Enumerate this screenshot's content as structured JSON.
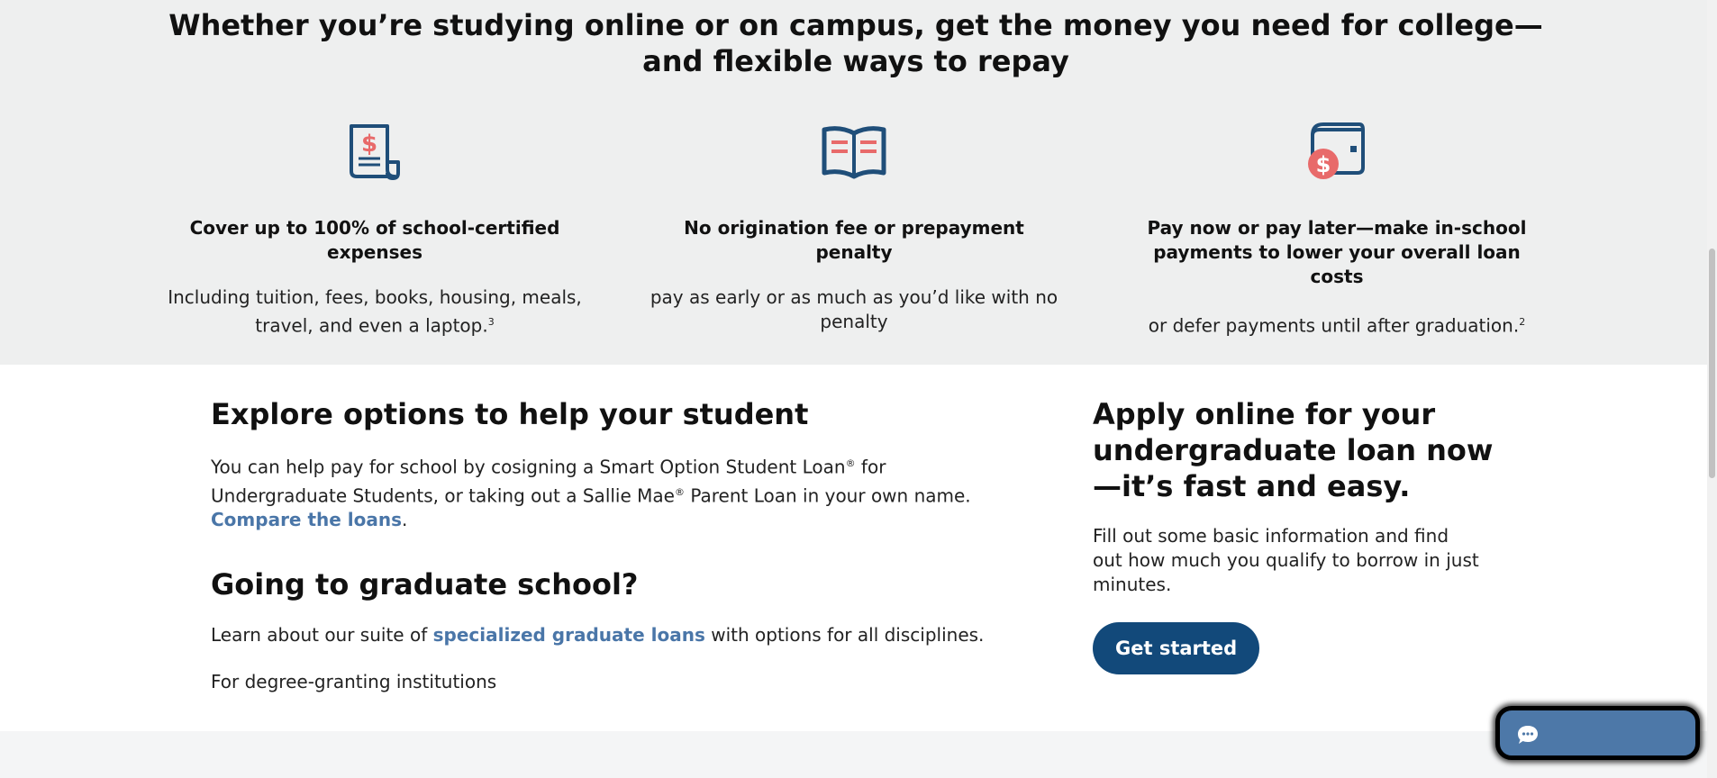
{
  "hero": {
    "title": "Whether you’re studying online or on campus, get the money you need for college—and flexible ways to repay"
  },
  "features": [
    {
      "icon": "document-dollar-icon",
      "title": "Cover up to 100% of school-certified expenses",
      "text": "Including tuition, fees, books, housing, meals, travel, and even a laptop.",
      "footnote": "3"
    },
    {
      "icon": "open-book-icon",
      "title": "No origination fee or prepayment penalty",
      "text": "pay as early or as much as you’d like with no penalty",
      "footnote": ""
    },
    {
      "icon": "wallet-dollar-icon",
      "title": "Pay now or pay later—make in-school payments to lower your overall loan costs",
      "text": "or defer payments until after graduation.",
      "footnote": "2"
    }
  ],
  "explore": {
    "heading": "Explore options to help your student",
    "text_part1": "You can help pay for school by cosigning a Smart Option Student Loan",
    "reg1": "®",
    "text_part2": " for Undergraduate Students, or taking out a Sallie Mae",
    "reg2": "®",
    "text_part3": " Parent Loan in your own name. ",
    "link": "Compare the loans",
    "text_end": "."
  },
  "graduate": {
    "heading": "Going to graduate school?",
    "text_before": "Learn about our suite of ",
    "link": "specialized graduate loans",
    "text_after": " with options for all disciplines.",
    "note": "For degree-granting institutions"
  },
  "apply": {
    "heading": "Apply online for your undergraduate loan now—it’s fast and easy.",
    "text": "Fill out some basic information and find out how much you qualify to borrow in just minutes.",
    "button": "Get started"
  },
  "chat": {
    "icon": "chat-bubble-icon"
  },
  "colors": {
    "navy": "#12497a",
    "icon_navy": "#1f4e79",
    "accent_red": "#e86a6a",
    "link": "#4a76a8",
    "gray_band": "#eeefef",
    "chat_bg": "#4d78a8"
  }
}
